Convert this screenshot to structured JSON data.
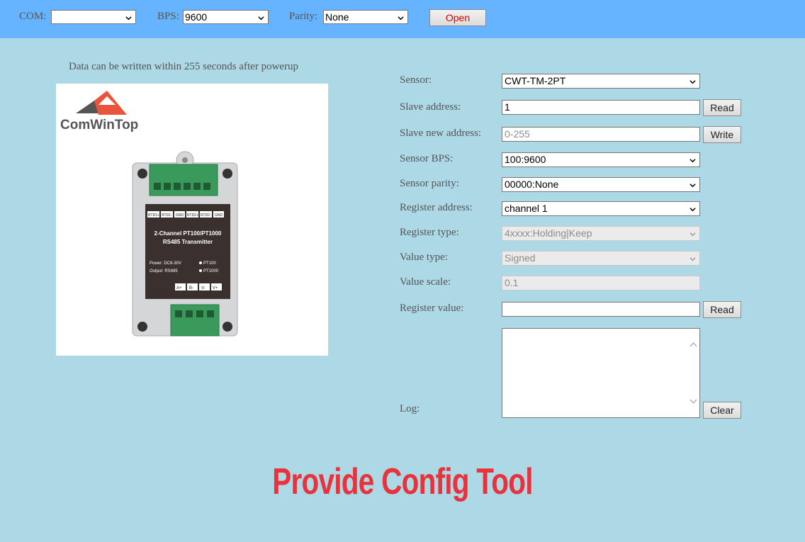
{
  "topbar": {
    "com_label": "COM:",
    "com_value": "",
    "bps_label": "BPS:",
    "bps_value": "9600",
    "parity_label": "Parity:",
    "parity_value": "None",
    "open_button": "Open"
  },
  "caption": "Data can be written within 255 seconds after powerup",
  "product": {
    "brand": "ComWinTop",
    "terminals_top": [
      "RTD1+",
      "RTD1-",
      "GND",
      "RTD2+",
      "RTD2-",
      "GND"
    ],
    "title_line1": "2-Channel PT100/PT1000",
    "title_line2": "RS485 Transmitter",
    "power": "Power: DC8-30V",
    "output": "Output: RS485",
    "opt1": "PT100",
    "opt2": "PT1000",
    "terminals_bottom": [
      "A+",
      "B-",
      "V-",
      "V+"
    ]
  },
  "form": {
    "sensor_label": "Sensor:",
    "sensor_value": "CWT-TM-2PT",
    "slave_label": "Slave address:",
    "slave_value": "1",
    "read_button": "Read",
    "new_addr_label": "Slave new address:",
    "new_addr_placeholder": "0-255",
    "write_button": "Write",
    "bps_label": "Sensor BPS:",
    "bps_value": "100:9600",
    "parity_label": "Sensor parity:",
    "parity_value": "00000:None",
    "reg_addr_label": "Register address:",
    "reg_addr_value": "channel 1",
    "reg_type_label": "Register type:",
    "reg_type_value": "4xxxx:Holding|Keep",
    "value_type_label": "Value type:",
    "value_type_value": "Signed",
    "scale_label": "Value scale:",
    "scale_value": "0.1",
    "reg_value_label": "Register value:",
    "reg_value_value": "",
    "read2_button": "Read",
    "log_label": "Log:",
    "log_value": "",
    "clear_button": "Clear"
  },
  "promo": "Provide Config Tool",
  "colors": {
    "topbar": "#66b3ff",
    "background": "#add8e6",
    "promo": "#e8323c",
    "open_text": "#e00000"
  }
}
